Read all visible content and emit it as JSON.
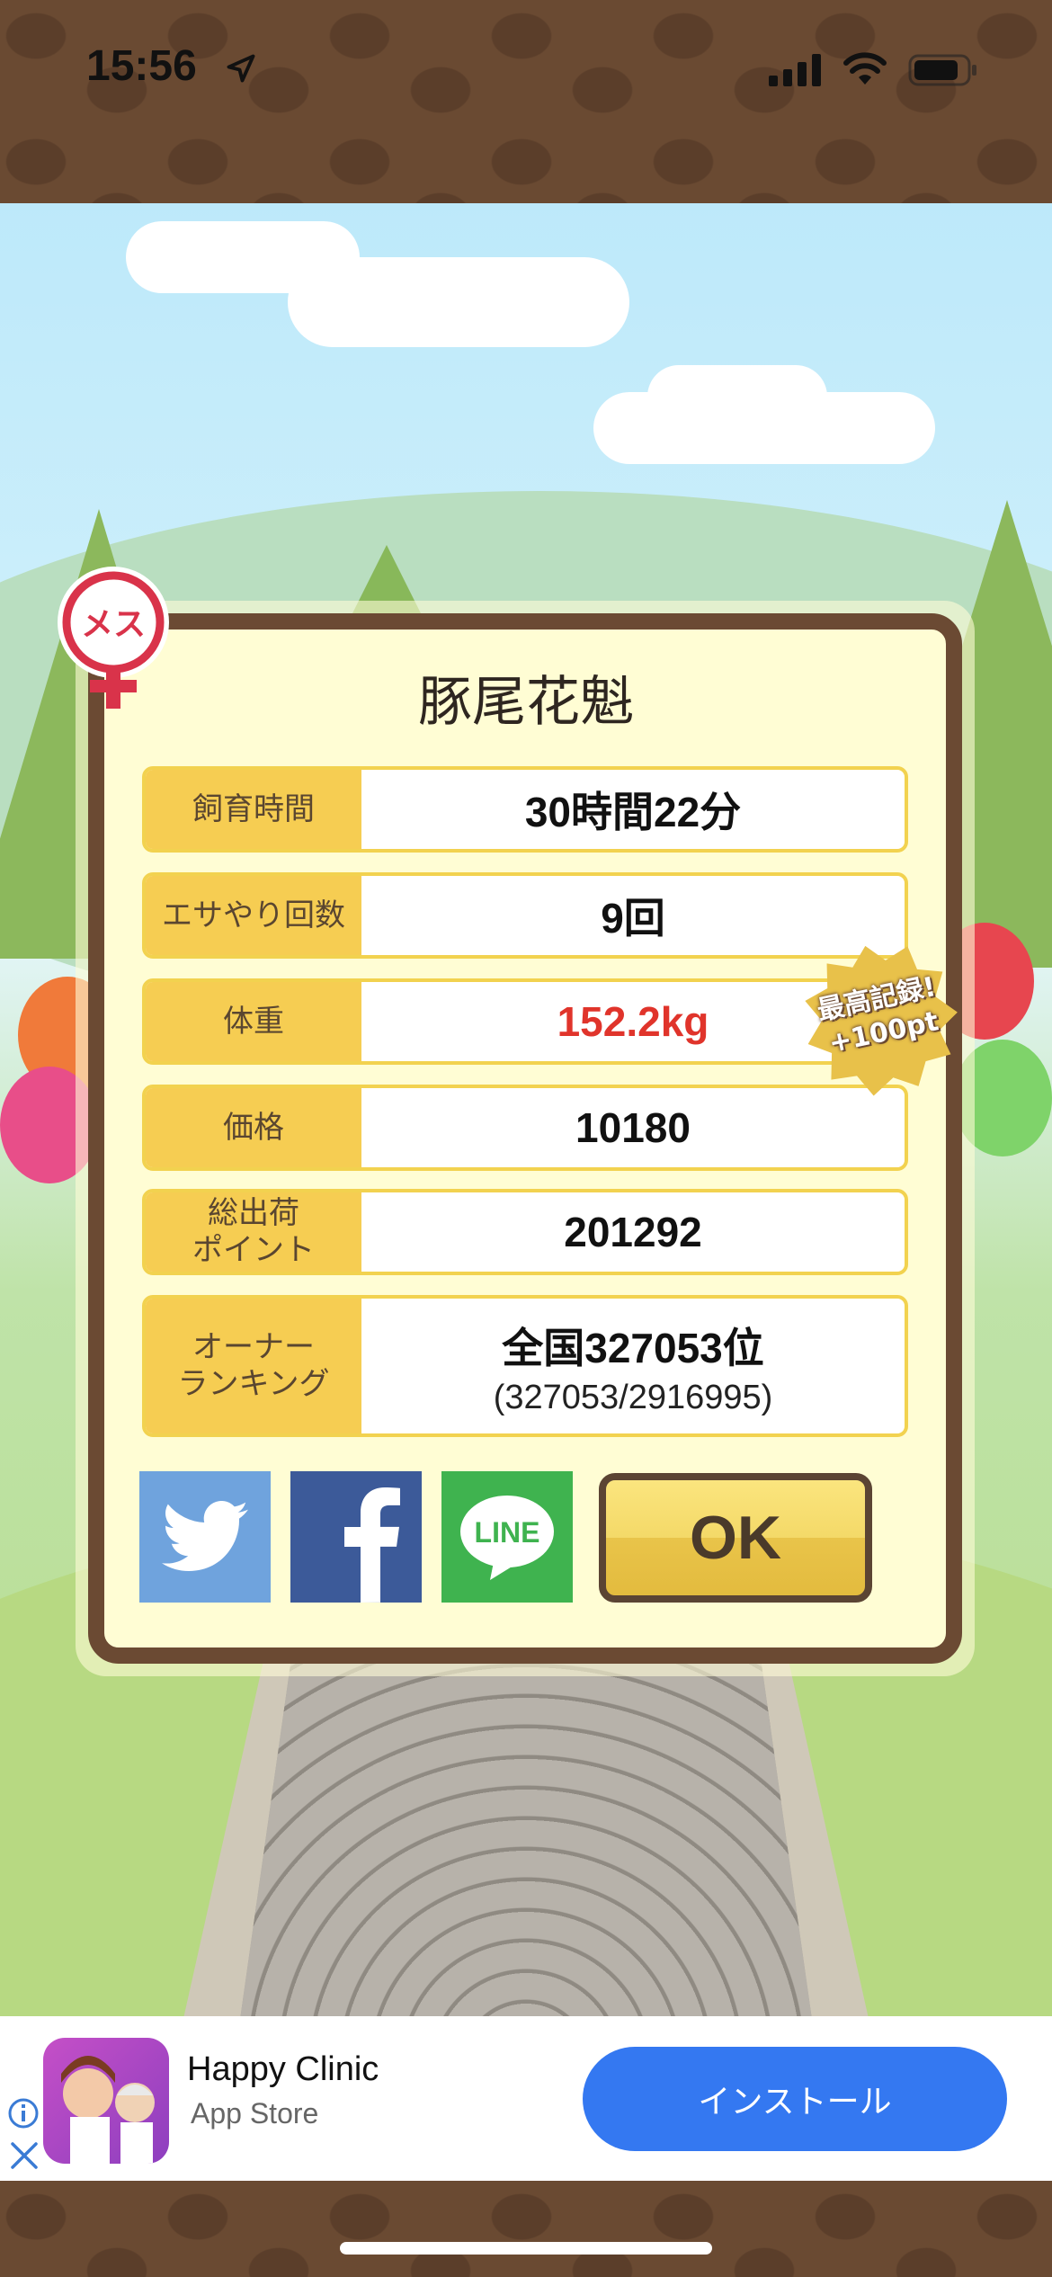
{
  "status_bar": {
    "time": "15:56"
  },
  "dialog": {
    "title": "豚尾花魁",
    "rows": [
      {
        "label": "飼育時間",
        "value": "30時間22分"
      },
      {
        "label": "エサやり回数",
        "value": "9回"
      },
      {
        "label": "体重",
        "value": "152.2kg"
      },
      {
        "label": "価格",
        "value": "10180"
      },
      {
        "label": "総出荷\nポイント",
        "value": "201292"
      }
    ],
    "ranking": {
      "label": "オーナー\nランキング",
      "value": "全国327053位",
      "detail": "(327053/2916995)"
    },
    "gender_badge": "メス",
    "record_badge": {
      "line1": "最高記録!",
      "line2": "+100pt"
    },
    "ok_label": "OK",
    "share": {
      "line_label": "LINE"
    }
  },
  "ad": {
    "title": "Happy Clinic",
    "store": "App Store",
    "install_label": "インストール"
  },
  "colors": {
    "accent": "#f6cd52",
    "frame": "#6b4a33",
    "weight_value": "#e0342b",
    "install": "#3478f1"
  }
}
